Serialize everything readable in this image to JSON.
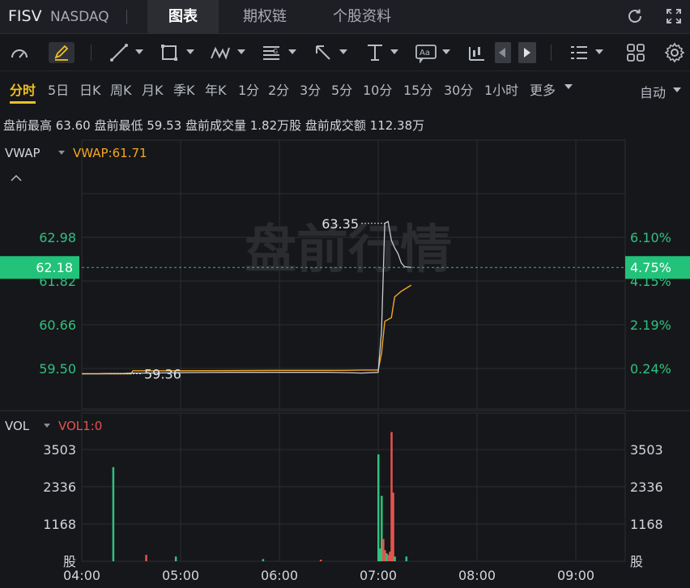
{
  "header": {
    "ticker": "FISV",
    "exchange": "NASDAQ",
    "tabs": [
      {
        "label": "图表",
        "active": true
      },
      {
        "label": "期权链",
        "active": false
      },
      {
        "label": "个股资料",
        "active": false
      }
    ],
    "icons": [
      "refresh-icon",
      "fullscreen-icon"
    ]
  },
  "toolbar": {
    "icons": [
      "indicator-gauge-icon",
      "draw-pencil-icon",
      "line-tool-icon",
      "rectangle-tool-icon",
      "pattern-tool-icon",
      "fibonacci-tool-icon",
      "arrow-tool-icon",
      "measure-tool-icon",
      "text-tool-icon",
      "candle-type-icon",
      "prev-icon",
      "next-icon",
      "layout-list-icon",
      "grid-icon",
      "settings-icon"
    ]
  },
  "periods": {
    "items": [
      "分时",
      "5日",
      "日K",
      "周K",
      "月K",
      "季K",
      "年K",
      "1分",
      "2分",
      "3分",
      "5分",
      "10分",
      "15分",
      "30分",
      "1小时",
      "更多"
    ],
    "active_index": 0,
    "right": "自动"
  },
  "infobar": {
    "text": "盘前最高 63.60  盘前最低 59.53  盘前成交量 1.82万股  盘前成交额 112.38万"
  },
  "colors": {
    "up": "#2ec27e",
    "down": "#e5534b",
    "vwap": "#f5a623",
    "price": "#c8ccd2",
    "bg": "#16171b",
    "grid": "#2a2c31",
    "current_bg": "#22c27a"
  },
  "chart_data": {
    "type": "line",
    "watermark": "盘前行情",
    "price_panel": {
      "indicator_label": "VWAP",
      "indicator_value_label": "VWAP:61.71",
      "y_ticks": [
        "62.98",
        "61.82",
        "60.66",
        "59.50"
      ],
      "pct_ticks": [
        "6.10%",
        "4.15%",
        "2.19%",
        "0.24%"
      ],
      "current_price": "62.18",
      "current_pct": "4.75%",
      "high_marker": "63.35",
      "low_marker": "59.36",
      "price_series": [
        {
          "t": "04:00",
          "v": 59.36
        },
        {
          "t": "04:05",
          "v": 59.36
        },
        {
          "t": "04:10",
          "v": 59.36
        },
        {
          "t": "04:15",
          "v": 59.37
        },
        {
          "t": "04:20",
          "v": 59.37
        },
        {
          "t": "04:25",
          "v": 59.37
        },
        {
          "t": "04:30",
          "v": 59.38
        },
        {
          "t": "04:40",
          "v": 59.38
        },
        {
          "t": "05:00",
          "v": 59.39
        },
        {
          "t": "05:30",
          "v": 59.4
        },
        {
          "t": "06:00",
          "v": 59.4
        },
        {
          "t": "06:30",
          "v": 59.4
        },
        {
          "t": "06:40",
          "v": 59.39
        },
        {
          "t": "06:50",
          "v": 59.38
        },
        {
          "t": "07:00",
          "v": 59.4
        },
        {
          "t": "07:02",
          "v": 60.5
        },
        {
          "t": "07:03",
          "v": 61.9
        },
        {
          "t": "07:04",
          "v": 63.35
        },
        {
          "t": "07:06",
          "v": 63.4
        },
        {
          "t": "07:08",
          "v": 62.9
        },
        {
          "t": "07:10",
          "v": 62.7
        },
        {
          "t": "07:12",
          "v": 62.55
        },
        {
          "t": "07:14",
          "v": 62.3
        },
        {
          "t": "07:16",
          "v": 62.2
        },
        {
          "t": "07:20",
          "v": 62.18
        }
      ],
      "vwap_series": [
        {
          "t": "04:00",
          "v": 59.36
        },
        {
          "t": "04:30",
          "v": 59.36
        },
        {
          "t": "04:31",
          "v": 59.44
        },
        {
          "t": "05:00",
          "v": 59.44
        },
        {
          "t": "06:00",
          "v": 59.45
        },
        {
          "t": "06:40",
          "v": 59.45
        },
        {
          "t": "06:50",
          "v": 59.46
        },
        {
          "t": "07:00",
          "v": 59.46
        },
        {
          "t": "07:02",
          "v": 59.9
        },
        {
          "t": "07:04",
          "v": 60.75
        },
        {
          "t": "07:08",
          "v": 60.85
        },
        {
          "t": "07:10",
          "v": 61.4
        },
        {
          "t": "07:14",
          "v": 61.55
        },
        {
          "t": "07:20",
          "v": 61.71
        }
      ]
    },
    "volume_panel": {
      "indicator_label": "VOL",
      "indicator_value_label": "VOL1:0",
      "y_ticks": [
        "3503",
        "2336",
        "1168",
        "股"
      ],
      "bars": [
        {
          "t": "04:19",
          "v": 2950,
          "dir": "up"
        },
        {
          "t": "04:39",
          "v": 200,
          "dir": "down"
        },
        {
          "t": "04:57",
          "v": 150,
          "dir": "up"
        },
        {
          "t": "05:50",
          "v": 70,
          "dir": "up"
        },
        {
          "t": "06:25",
          "v": 50,
          "dir": "down"
        },
        {
          "t": "07:00",
          "v": 3350,
          "dir": "up"
        },
        {
          "t": "07:01",
          "v": 400,
          "dir": "up"
        },
        {
          "t": "07:02",
          "v": 2050,
          "dir": "up"
        },
        {
          "t": "07:03",
          "v": 700,
          "dir": "down"
        },
        {
          "t": "07:04",
          "v": 350,
          "dir": "down"
        },
        {
          "t": "07:05",
          "v": 250,
          "dir": "up"
        },
        {
          "t": "07:06",
          "v": 200,
          "dir": "down"
        },
        {
          "t": "07:07",
          "v": 300,
          "dir": "down"
        },
        {
          "t": "07:08",
          "v": 4050,
          "dir": "down"
        },
        {
          "t": "07:09",
          "v": 2150,
          "dir": "down"
        },
        {
          "t": "07:10",
          "v": 150,
          "dir": "up"
        },
        {
          "t": "07:17",
          "v": 150,
          "dir": "up"
        }
      ]
    },
    "x_ticks": [
      "04:00",
      "05:00",
      "06:00",
      "07:00",
      "08:00",
      "09:00"
    ],
    "x_range": [
      "04:00",
      "09:30"
    ]
  }
}
